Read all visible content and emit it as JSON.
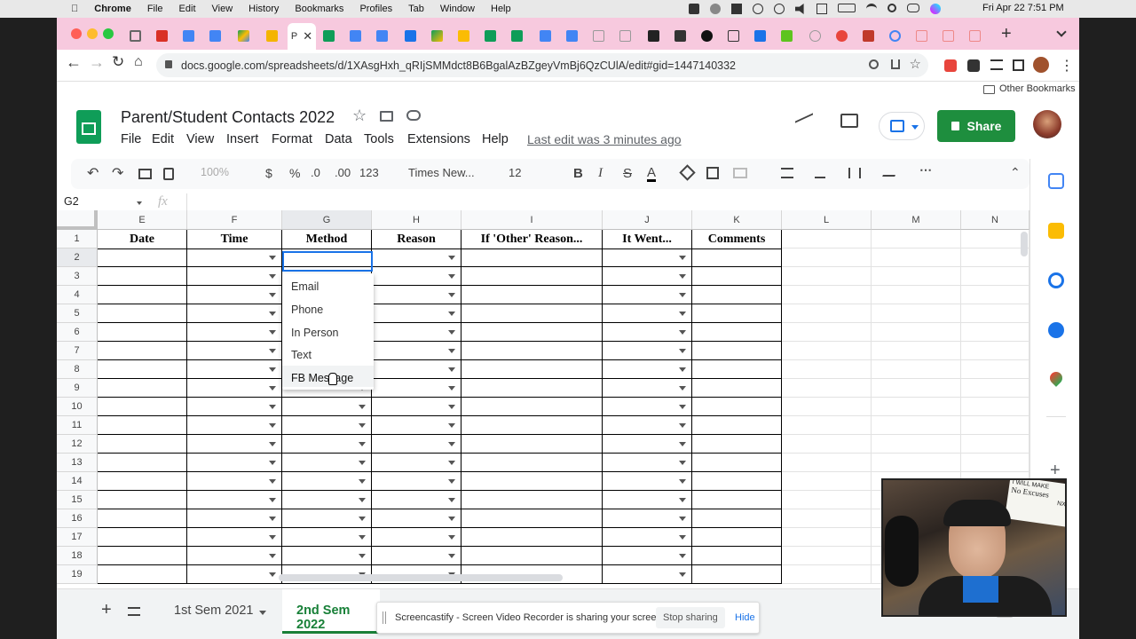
{
  "macos": {
    "apple_icon": "apple-icon",
    "app_name": "Chrome",
    "menus": [
      "File",
      "Edit",
      "View",
      "History",
      "Bookmarks",
      "Profiles",
      "Tab",
      "Window",
      "Help"
    ],
    "datetime": "Fri Apr 22  7:51 PM"
  },
  "browser": {
    "active_tab_letter": "P",
    "url": "docs.google.com/spreadsheets/d/1XAsgHxh_qRIjSMMdct8B6BgalAzBZgeyVmBj6QzCUlA/edit#gid=1447140332",
    "other_bookmarks": "Other Bookmarks"
  },
  "doc": {
    "title": "Parent/Student Contacts 2022",
    "menus": [
      "File",
      "Edit",
      "View",
      "Insert",
      "Format",
      "Data",
      "Tools",
      "Extensions",
      "Help"
    ],
    "last_edit": "Last edit was 3 minutes ago",
    "share_label": "Share"
  },
  "toolbar": {
    "zoom": "100%",
    "currency": "$",
    "percent": "%",
    "dec_decrease": ".0",
    "dec_increase": ".00",
    "number_format": "123",
    "font": "Times New...",
    "font_size": "12",
    "bold": "B",
    "italic": "I",
    "strike": "S",
    "text_color": "A"
  },
  "formula_bar": {
    "cell_ref": "G2",
    "fx": "fx"
  },
  "grid": {
    "columns": [
      "E",
      "F",
      "G",
      "H",
      "I",
      "J",
      "K",
      "L",
      "M",
      "N"
    ],
    "headers": [
      "Date",
      "Time",
      "Method",
      "Reason",
      "If 'Other' Reason...",
      "It Went...",
      "Comments"
    ],
    "rows": [
      "1",
      "2",
      "3",
      "4",
      "5",
      "6",
      "7",
      "8",
      "9",
      "10",
      "11",
      "12",
      "13",
      "14",
      "15",
      "16",
      "17",
      "18",
      "19"
    ],
    "selected_cell": "G2"
  },
  "dropdown": {
    "options": [
      "Email",
      "Phone",
      "In Person",
      "Text",
      "FB Message"
    ]
  },
  "sheet_tabs": {
    "tabs": [
      "1st Sem 2021",
      "2nd Sem 2022"
    ],
    "active": "2nd Sem 2022"
  },
  "screencastify": {
    "message": "Screencastify - Screen Video Recorder is sharing your screen.",
    "stop": "Stop sharing",
    "hide": "Hide"
  },
  "webcam": {
    "sign_lines": [
      "I WILL MAKE",
      "No Excuses",
      "NX"
    ]
  },
  "colors": {
    "tabstrip": "#f7c9de",
    "share_green": "#1e8e3e",
    "selection_blue": "#1a73e8",
    "sheets_green": "#0f9d58"
  }
}
